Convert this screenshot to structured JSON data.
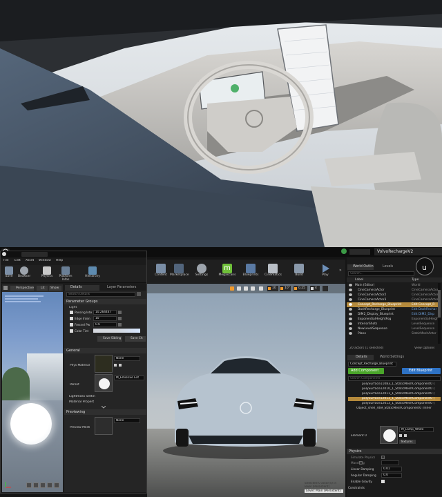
{
  "editor": {
    "tab_title": "VolvoRechargeV2",
    "file_menu": [
      "File",
      "Edit",
      "Asset",
      "Window",
      "Help"
    ],
    "left_toolbar": [
      "Save",
      "Browser",
      "Physics",
      "Platform Infos",
      "Hierarchy"
    ],
    "main_toolbar": [
      "Content",
      "Marketplace",
      "Settings",
      "Megascans",
      "Blueprints",
      "Cinematics",
      "Build",
      "Play"
    ],
    "preview_tabs": {
      "perspective": "Perspective",
      "lit": "Lit",
      "show": "Show"
    },
    "details_tabs": [
      "Details",
      "Layer Parameters"
    ],
    "search_placeholder": "Search Details",
    "parameter_groups": "Parameter Groups",
    "light_group": "Light",
    "params": [
      {
        "name": "Passing Inte",
        "value": "10.264447"
      },
      {
        "name": "Edge Inten",
        "value": "10"
      },
      {
        "name": "Fresnel Pw",
        "value": "0.6"
      },
      {
        "name": "Color Tint",
        "value": ""
      }
    ],
    "save_sibling": "Save Sibling",
    "save_child": "Save Ch",
    "general_section": "General",
    "phys_material": "Phys Material",
    "phys_value": "None",
    "parent": "Parent",
    "parent_value": "M_Emissive Ext",
    "lightmass": "Lightmass Settin",
    "material_property": "Material Propert",
    "previewing": "Previewing",
    "preview_mesh": "Preview Mesh",
    "preview_mesh_value": "None",
    "viewport_tools": [
      "10",
      "10°",
      "0.25",
      "4"
    ],
    "status_selected": "Selected 0 actor(s) in",
    "status_level_current": "level (Persistent)",
    "level_badge": "Level: Main (Persistent)",
    "outliner_tabs": [
      "World Outlin",
      "Levels"
    ],
    "outliner_search": "Search...",
    "outliner_headers": [
      "Label",
      "Type"
    ],
    "outliner_items": [
      {
        "label": "Main (Editor)",
        "type": "World"
      },
      {
        "label": "CineCameraActor",
        "type": "CineCameraActor"
      },
      {
        "label": "CineCameraActor2",
        "type": "CineCameraActor"
      },
      {
        "label": "CineCameraActor3",
        "type": "CineCameraActor"
      },
      {
        "label": "Concept_Recharge_Blueprint",
        "type": "Edit Concept_R"
      },
      {
        "label": "DashRecharge_Blueprint",
        "type": "Edit DashRechar"
      },
      {
        "label": "DIM2_Display_Blueprint",
        "type": "Edit DIM2_Disp"
      },
      {
        "label": "ExponentialHeightFog",
        "type": "ExponentialHeightF"
      },
      {
        "label": "InteriorShots",
        "type": "LevelSequence"
      },
      {
        "label": "NewLevelSequence",
        "type": "LevelSequence"
      },
      {
        "label": "Plane",
        "type": "StaticMeshActor"
      }
    ],
    "actor_count": "20 actors (1 selected)",
    "view_options": "View Options",
    "right_details_tabs": [
      "Details",
      "World Settings"
    ],
    "selected_actor": "Concept_Recharge_Blueprint",
    "add_component": "Add Component",
    "edit_blueprint": "Edit Blueprint",
    "search_components": "Search Components",
    "components": [
      "polySurface11083_1_StaticMeshComponent0 (",
      "polySurface12010_1_StaticMeshComponent0 (",
      "polySurface12011_1_StaticMeshComponent0 (",
      "polySurface12013_1_StaticMeshComponent0 (",
      "polySurface12013_1_StaticMeshComponent0 (",
      "Object_shell_469_StaticMeshComponent0 (Inher"
    ],
    "element_label": "Element 0",
    "element_material": "M_Lamp_White",
    "textures_btn": "Textures",
    "physics_section": "Physics",
    "physics_rows": [
      {
        "name": "Simulate Physics",
        "value": ""
      },
      {
        "name": "MassInKg",
        "value": ""
      },
      {
        "name": "Linear Damping",
        "value": "0.01"
      },
      {
        "name": "Angular Damping",
        "value": "0.0"
      },
      {
        "name": "Enable Gravity",
        "value": ""
      },
      {
        "name": "Constraints",
        "value": ""
      }
    ]
  }
}
